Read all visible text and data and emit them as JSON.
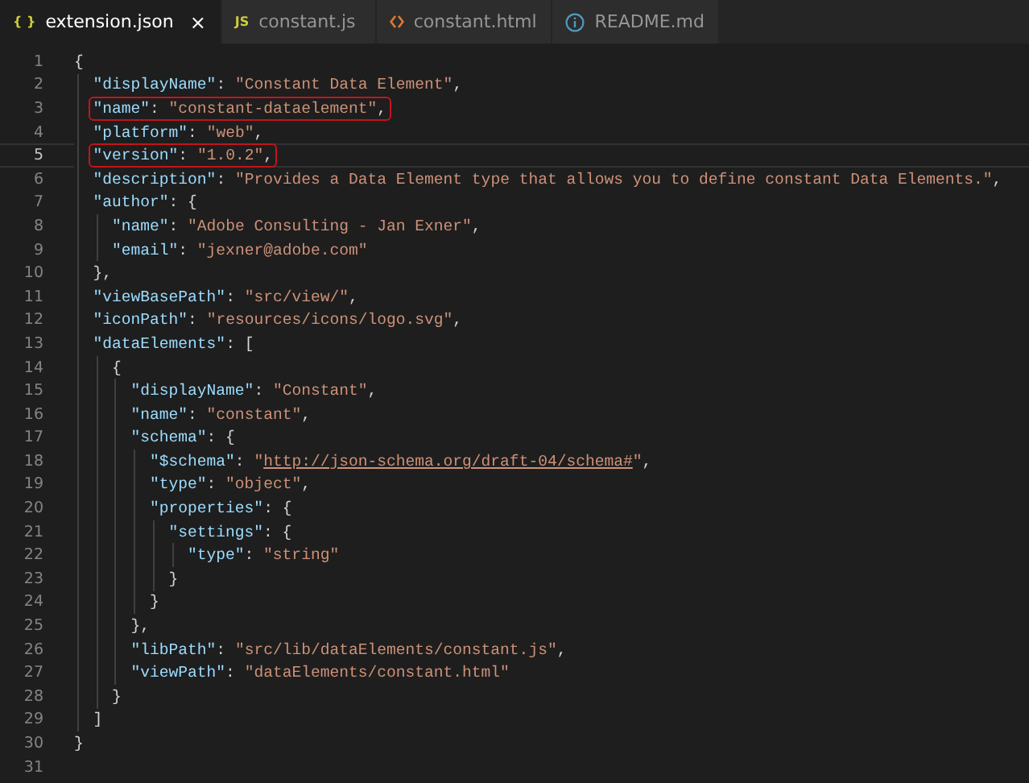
{
  "tabs": [
    {
      "label": "extension.json",
      "selected": true,
      "icon": {
        "kind": "text",
        "text": "{ }",
        "color": "#cbcb41"
      },
      "close": "×"
    },
    {
      "label": "constant.js",
      "selected": false,
      "icon": {
        "kind": "text",
        "text": "JS",
        "color": "#cbcb41"
      }
    },
    {
      "label": "constant.html",
      "selected": false,
      "icon": {
        "kind": "code",
        "color": "#e37933"
      }
    },
    {
      "label": "README.md",
      "selected": false,
      "icon": {
        "kind": "info",
        "color": "#519aba"
      }
    }
  ],
  "lines": [
    {
      "number": "1",
      "current": false,
      "boxed": false,
      "tokens": [
        {
          "kind": "punct",
          "text": "{"
        }
      ],
      "children": [
        {
          "number": "2",
          "current": false,
          "boxed": false,
          "tokens": [
            {
              "kind": "key",
              "text": "\"displayName\""
            },
            {
              "kind": "punct",
              "text": ": "
            },
            {
              "kind": "string",
              "text": "\"Constant Data Element\""
            },
            {
              "kind": "punct",
              "text": ","
            }
          ]
        },
        {
          "number": "3",
          "current": false,
          "boxed": true,
          "tokens": [
            {
              "kind": "key",
              "text": "\"name\""
            },
            {
              "kind": "punct",
              "text": ": "
            },
            {
              "kind": "string",
              "text": "\"constant-dataelement\""
            },
            {
              "kind": "punct",
              "text": ","
            }
          ]
        },
        {
          "number": "4",
          "current": false,
          "boxed": false,
          "tokens": [
            {
              "kind": "key",
              "text": "\"platform\""
            },
            {
              "kind": "punct",
              "text": ": "
            },
            {
              "kind": "string",
              "text": "\"web\""
            },
            {
              "kind": "punct",
              "text": ","
            }
          ]
        },
        {
          "number": "5",
          "current": true,
          "boxed": true,
          "tokens": [
            {
              "kind": "key",
              "text": "\"version\""
            },
            {
              "kind": "punct",
              "text": ": "
            },
            {
              "kind": "string",
              "text": "\"1.0.2\""
            },
            {
              "kind": "punct",
              "text": ","
            }
          ]
        },
        {
          "number": "6",
          "current": false,
          "boxed": false,
          "tokens": [
            {
              "kind": "key",
              "text": "\"description\""
            },
            {
              "kind": "punct",
              "text": ": "
            },
            {
              "kind": "string",
              "text": "\"Provides a Data Element type that allows you to define constant Data Elements.\""
            },
            {
              "kind": "punct",
              "text": ","
            }
          ]
        },
        {
          "number": "7",
          "current": false,
          "boxed": false,
          "tokens": [
            {
              "kind": "key",
              "text": "\"author\""
            },
            {
              "kind": "punct",
              "text": ": {"
            }
          ],
          "children": [
            {
              "number": "8",
              "current": false,
              "boxed": false,
              "tokens": [
                {
                  "kind": "key",
                  "text": "\"name\""
                },
                {
                  "kind": "punct",
                  "text": ": "
                },
                {
                  "kind": "string",
                  "text": "\"Adobe Consulting - Jan Exner\""
                },
                {
                  "kind": "punct",
                  "text": ","
                }
              ]
            },
            {
              "number": "9",
              "current": false,
              "boxed": false,
              "tokens": [
                {
                  "kind": "key",
                  "text": "\"email\""
                },
                {
                  "kind": "punct",
                  "text": ": "
                },
                {
                  "kind": "string",
                  "text": "\"jexner@adobe.com\""
                }
              ]
            }
          ]
        },
        {
          "number": "10",
          "current": false,
          "boxed": false,
          "tokens": [
            {
              "kind": "punct",
              "text": "},"
            }
          ]
        },
        {
          "number": "11",
          "current": false,
          "boxed": false,
          "tokens": [
            {
              "kind": "key",
              "text": "\"viewBasePath\""
            },
            {
              "kind": "punct",
              "text": ": "
            },
            {
              "kind": "string",
              "text": "\"src/view/\""
            },
            {
              "kind": "punct",
              "text": ","
            }
          ]
        },
        {
          "number": "12",
          "current": false,
          "boxed": false,
          "tokens": [
            {
              "kind": "key",
              "text": "\"iconPath\""
            },
            {
              "kind": "punct",
              "text": ": "
            },
            {
              "kind": "string",
              "text": "\"resources/icons/logo.svg\""
            },
            {
              "kind": "punct",
              "text": ","
            }
          ]
        },
        {
          "number": "13",
          "current": false,
          "boxed": false,
          "tokens": [
            {
              "kind": "key",
              "text": "\"dataElements\""
            },
            {
              "kind": "punct",
              "text": ": ["
            }
          ],
          "children": [
            {
              "number": "14",
              "current": false,
              "boxed": false,
              "tokens": [
                {
                  "kind": "punct",
                  "text": "{"
                }
              ],
              "children": [
                {
                  "number": "15",
                  "current": false,
                  "boxed": false,
                  "tokens": [
                    {
                      "kind": "key",
                      "text": "\"displayName\""
                    },
                    {
                      "kind": "punct",
                      "text": ": "
                    },
                    {
                      "kind": "string",
                      "text": "\"Constant\""
                    },
                    {
                      "kind": "punct",
                      "text": ","
                    }
                  ]
                },
                {
                  "number": "16",
                  "current": false,
                  "boxed": false,
                  "tokens": [
                    {
                      "kind": "key",
                      "text": "\"name\""
                    },
                    {
                      "kind": "punct",
                      "text": ": "
                    },
                    {
                      "kind": "string",
                      "text": "\"constant\""
                    },
                    {
                      "kind": "punct",
                      "text": ","
                    }
                  ]
                },
                {
                  "number": "17",
                  "current": false,
                  "boxed": false,
                  "tokens": [
                    {
                      "kind": "key",
                      "text": "\"schema\""
                    },
                    {
                      "kind": "punct",
                      "text": ": {"
                    }
                  ],
                  "children": [
                    {
                      "number": "18",
                      "current": false,
                      "boxed": false,
                      "tokens": [
                        {
                          "kind": "key",
                          "text": "\"$schema\""
                        },
                        {
                          "kind": "punct",
                          "text": ": "
                        },
                        {
                          "kind": "string",
                          "text": "\""
                        },
                        {
                          "kind": "link",
                          "text": "http://json-schema.org/draft-04/schema#"
                        },
                        {
                          "kind": "string",
                          "text": "\""
                        },
                        {
                          "kind": "punct",
                          "text": ","
                        }
                      ]
                    },
                    {
                      "number": "19",
                      "current": false,
                      "boxed": false,
                      "tokens": [
                        {
                          "kind": "key",
                          "text": "\"type\""
                        },
                        {
                          "kind": "punct",
                          "text": ": "
                        },
                        {
                          "kind": "string",
                          "text": "\"object\""
                        },
                        {
                          "kind": "punct",
                          "text": ","
                        }
                      ]
                    },
                    {
                      "number": "20",
                      "current": false,
                      "boxed": false,
                      "tokens": [
                        {
                          "kind": "key",
                          "text": "\"properties\""
                        },
                        {
                          "kind": "punct",
                          "text": ": {"
                        }
                      ],
                      "children": [
                        {
                          "number": "21",
                          "current": false,
                          "boxed": false,
                          "tokens": [
                            {
                              "kind": "key",
                              "text": "\"settings\""
                            },
                            {
                              "kind": "punct",
                              "text": ": {"
                            }
                          ],
                          "children": [
                            {
                              "number": "22",
                              "current": false,
                              "boxed": false,
                              "tokens": [
                                {
                                  "kind": "key",
                                  "text": "\"type\""
                                },
                                {
                                  "kind": "punct",
                                  "text": ": "
                                },
                                {
                                  "kind": "string",
                                  "text": "\"string\""
                                }
                              ]
                            }
                          ]
                        },
                        {
                          "number": "23",
                          "current": false,
                          "boxed": false,
                          "tokens": [
                            {
                              "kind": "punct",
                              "text": "}"
                            }
                          ]
                        }
                      ]
                    },
                    {
                      "number": "24",
                      "current": false,
                      "boxed": false,
                      "tokens": [
                        {
                          "kind": "punct",
                          "text": "}"
                        }
                      ]
                    }
                  ]
                },
                {
                  "number": "25",
                  "current": false,
                  "boxed": false,
                  "tokens": [
                    {
                      "kind": "punct",
                      "text": "},"
                    }
                  ]
                },
                {
                  "number": "26",
                  "current": false,
                  "boxed": false,
                  "tokens": [
                    {
                      "kind": "key",
                      "text": "\"libPath\""
                    },
                    {
                      "kind": "punct",
                      "text": ": "
                    },
                    {
                      "kind": "string",
                      "text": "\"src/lib/dataElements/constant.js\""
                    },
                    {
                      "kind": "punct",
                      "text": ","
                    }
                  ]
                },
                {
                  "number": "27",
                  "current": false,
                  "boxed": false,
                  "tokens": [
                    {
                      "kind": "key",
                      "text": "\"viewPath\""
                    },
                    {
                      "kind": "punct",
                      "text": ": "
                    },
                    {
                      "kind": "string",
                      "text": "\"dataElements/constant.html\""
                    }
                  ]
                }
              ]
            },
            {
              "number": "28",
              "current": false,
              "boxed": false,
              "tokens": [
                {
                  "kind": "punct",
                  "text": "}"
                }
              ]
            }
          ]
        },
        {
          "number": "29",
          "current": false,
          "boxed": false,
          "tokens": [
            {
              "kind": "punct",
              "text": "]"
            }
          ]
        }
      ]
    },
    {
      "number": "30",
      "current": false,
      "boxed": false,
      "tokens": [
        {
          "kind": "punct",
          "text": "}"
        }
      ]
    },
    {
      "number": "31",
      "current": false
    }
  ]
}
